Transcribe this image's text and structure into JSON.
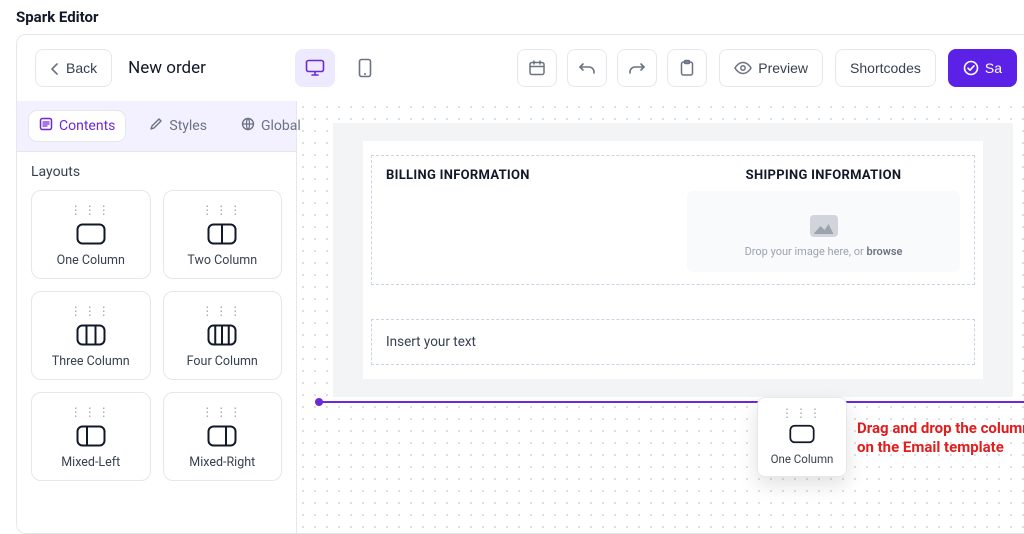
{
  "app": {
    "title": "Spark Editor"
  },
  "header": {
    "back_label": "Back",
    "page_title": "New order",
    "preview_label": "Preview",
    "shortcodes_label": "Shortcodes",
    "save_label": "Sa"
  },
  "tabs": {
    "contents": "Contents",
    "styles": "Styles",
    "global": "Global"
  },
  "sidebar": {
    "section_label": "Layouts",
    "layouts": [
      {
        "label": "One Column"
      },
      {
        "label": "Two Column"
      },
      {
        "label": "Three Column"
      },
      {
        "label": "Four Column"
      },
      {
        "label": "Mixed-Left"
      },
      {
        "label": "Mixed-Right"
      }
    ]
  },
  "canvas": {
    "billing_heading": "BILLING INFORMATION",
    "shipping_heading": "SHIPPING INFORMATION",
    "image_drop_prefix": "Drop your image here, or ",
    "image_drop_link": "browse",
    "insert_text": "Insert your text"
  },
  "drag_ghost": {
    "label": "One Column"
  },
  "hint": "Drag and drop the column on the Email template",
  "colors": {
    "accent": "#5b21e6",
    "hint": "#e11d1d"
  }
}
